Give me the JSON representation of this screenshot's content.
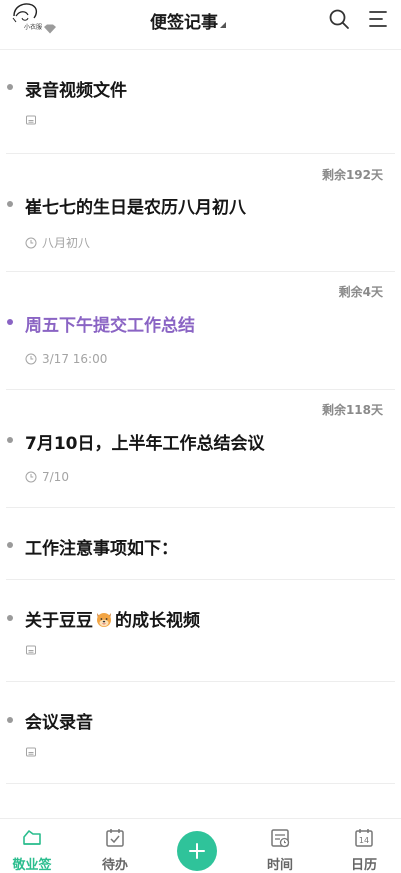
{
  "header": {
    "avatar_label": "小衣服",
    "title": "便签记事"
  },
  "notes": [
    {
      "title": "录音视频文件",
      "remaining": "",
      "meta_type": "attachment",
      "meta_text": ""
    },
    {
      "title": "崔七七的生日是农历八月初八",
      "remaining": "剩余192天",
      "meta_type": "clock",
      "meta_text": "八月初八"
    },
    {
      "title": "周五下午提交工作总结",
      "remaining": "剩余4天",
      "meta_type": "clock",
      "meta_text": "3/17  16:00",
      "highlight_color": "#8a64c4"
    },
    {
      "title": "7月10日，上半年工作总结会议",
      "remaining": "剩余118天",
      "meta_type": "clock",
      "meta_text": "7/10"
    },
    {
      "title": "工作注意事项如下：",
      "remaining": "",
      "meta_type": "none",
      "meta_text": ""
    },
    {
      "title_before_emoji": "关于豆豆",
      "emoji": "dog-face",
      "title_after_emoji": "的成长视频",
      "remaining": "",
      "meta_type": "attachment",
      "meta_text": ""
    },
    {
      "title": "会议录音",
      "remaining": "",
      "meta_type": "attachment",
      "meta_text": ""
    }
  ],
  "tabbar": {
    "items": [
      {
        "label": "敬业签",
        "icon": "notes-icon",
        "active": true
      },
      {
        "label": "待办",
        "icon": "todo-icon",
        "active": false
      },
      {
        "label": "",
        "icon": "add-icon",
        "active": false
      },
      {
        "label": "时间",
        "icon": "timeline-icon",
        "active": false
      },
      {
        "label": "日历",
        "icon": "calendar-icon",
        "active": false
      }
    ],
    "calendar_day": "14"
  },
  "colors": {
    "accent": "#2bbd8e",
    "fab": "#2fc39a",
    "purple": "#8a64c4",
    "muted": "#a4a4a4"
  }
}
